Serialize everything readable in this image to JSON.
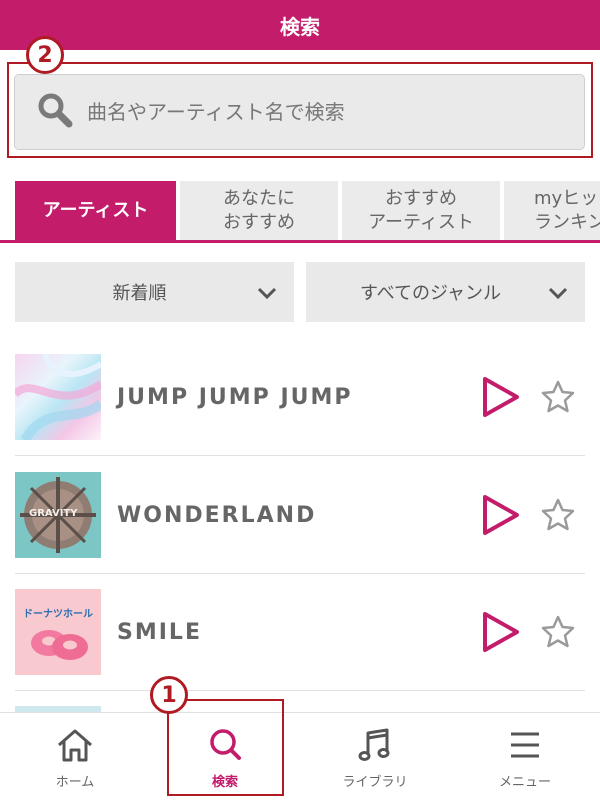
{
  "header": {
    "title": "検索"
  },
  "search": {
    "placeholder": "曲名やアーティスト名で検索",
    "icon": "search-icon"
  },
  "callouts": {
    "search_box": "2",
    "search_nav": "1",
    "color": "#b01a22"
  },
  "tabs": [
    {
      "label": "アーティスト",
      "active": true
    },
    {
      "label": "あなたに\nおすすめ",
      "active": false
    },
    {
      "label": "おすすめ\nアーティスト",
      "active": false
    },
    {
      "label": "myヒッ\nランキン",
      "active": false
    }
  ],
  "filters": {
    "sort": {
      "label": "新着順"
    },
    "genre": {
      "label": "すべてのジャンル"
    }
  },
  "songs": [
    {
      "title": "JUMP JUMP JUMP",
      "art_text": ""
    },
    {
      "title": "WONDERLAND",
      "art_text": "GRAVITY"
    },
    {
      "title": "SMILE",
      "art_text": "ドーナツホール"
    }
  ],
  "bottom_nav": [
    {
      "label": "ホーム",
      "icon": "home-icon",
      "active": false
    },
    {
      "label": "検索",
      "icon": "search-icon",
      "active": true
    },
    {
      "label": "ライブラリ",
      "icon": "music-note-icon",
      "active": false
    },
    {
      "label": "メニュー",
      "icon": "hamburger-menu-icon",
      "active": false
    }
  ],
  "colors": {
    "brand": "#c21c6a",
    "callout": "#b01a22"
  }
}
